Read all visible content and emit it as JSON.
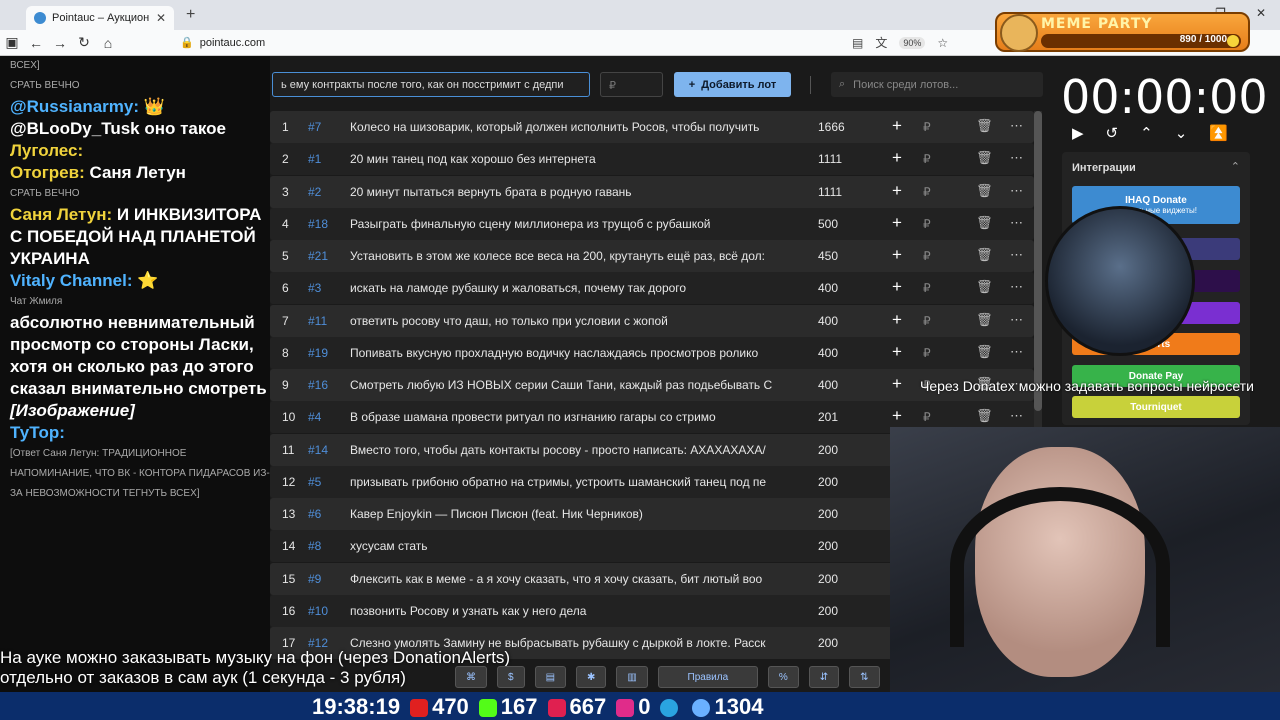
{
  "browser": {
    "tab_title": "Pointauc – Аукционы, лотереи",
    "url": "pointauc.com",
    "zoom": "90%"
  },
  "meme_party": {
    "title": "MEME PARTY",
    "progress": "890 / 1000",
    "progress_fraction": 0.89
  },
  "chat": {
    "lines": [
      {
        "kind": "small",
        "text": "ВСЕХ]"
      },
      {
        "kind": "small",
        "text": "СРАТЬ ВЕЧНО"
      },
      {
        "kind": "msg",
        "nick": "@Russianarmy:",
        "text": " 👑",
        "nick_color": "#4fb3ff"
      },
      {
        "kind": "msg",
        "nick": "@BLooDy_Tusk",
        "text": " оно такое",
        "nick_color": "#ffffff"
      },
      {
        "kind": "msg",
        "nick": "Луголес:",
        "text": "",
        "nick_color": "#f0d33c"
      },
      {
        "kind": "msg",
        "nick": "Отогрев:",
        "text": " Саня Летун",
        "nick_color": "#f0d33c"
      },
      {
        "kind": "small",
        "text": "СРАТЬ ВЕЧНО"
      },
      {
        "kind": "msg",
        "nick": "Саня Летун:",
        "text": " И ИНКВИЗИТОРА С ПОБЕДОЙ НАД ПЛАНЕТОЙ УКРАИНА",
        "nick_color": "#f0d33c"
      },
      {
        "kind": "msg",
        "nick": "Vitaly Channel:",
        "text": " ⭐",
        "nick_color": "#4fb3ff"
      },
      {
        "kind": "small",
        "text": "Чат Жмиля"
      },
      {
        "kind": "msg",
        "nick": "",
        "text": "абсолютно невнимательный просмотр со стороны Ласки, хотя он сколько раз до этого сказал внимательно смотреть",
        "nick_color": "#ffffff"
      },
      {
        "kind": "msg",
        "nick": "",
        "text": "[Изображение]",
        "nick_color": "#ffffff"
      },
      {
        "kind": "msg",
        "nick": "ТуТор:",
        "text": "",
        "nick_color": "#4fb3ff"
      },
      {
        "kind": "small",
        "text": "[Ответ Саня Летун: ТРАДИЦИОННОЕ НАПОМИНАНИЕ, ЧТО ВК - КОНТОРА ПИДАРАСОВ ИЗ-ЗА НЕВОЗМОЖНОСТИ ТЕГНУТЬ ВСЕХ]"
      }
    ]
  },
  "controls": {
    "lot_input": "ь ему контракты после того, как он посстримит с дедпи",
    "price_placeholder": "₽",
    "add_button": "Добавить лот",
    "search_placeholder": "Поиск среди лотов..."
  },
  "lots": [
    {
      "n": "1",
      "id": "#7",
      "name": "Колесо на шизоварик, который должен исполнить Росов, чтобы получить",
      "amount": "1666"
    },
    {
      "n": "2",
      "id": "#1",
      "name": "20 мин танец под как хорошо без интернета",
      "amount": "1111"
    },
    {
      "n": "3",
      "id": "#2",
      "name": "20 минут пытаться вернуть брата в родную гавань",
      "amount": "1111"
    },
    {
      "n": "4",
      "id": "#18",
      "name": "Разыграть финальную сцену миллионера из трущоб с рубашкой",
      "amount": "500"
    },
    {
      "n": "5",
      "id": "#21",
      "name": "Установить в этом же колесе все веса на 200, крутануть ещё раз, всё дол:",
      "amount": "450"
    },
    {
      "n": "6",
      "id": "#3",
      "name": "искать на ламоде рубашку и жаловаться, почему так дорого",
      "amount": "400"
    },
    {
      "n": "7",
      "id": "#11",
      "name": "ответить росову что даш, но только при условии с жопой",
      "amount": "400"
    },
    {
      "n": "8",
      "id": "#19",
      "name": "Попивать вкусную прохладную водичку наслаждаясь просмотров ролико",
      "amount": "400"
    },
    {
      "n": "9",
      "id": "#16",
      "name": "Смотреть любую ИЗ НОВЫХ серии Саши Тани, каждый раз подьебывать С",
      "amount": "400"
    },
    {
      "n": "10",
      "id": "#4",
      "name": "В образе шамана провести ритуал по изгнанию гагары со стримо",
      "amount": "201"
    },
    {
      "n": "11",
      "id": "#14",
      "name": "Вместо того, чтобы дать контакты росову - просто написать: АХАХАХАХА/",
      "amount": "200"
    },
    {
      "n": "12",
      "id": "#5",
      "name": "призывать грибоню обратно на стримы, устроить шаманский танец под пе",
      "amount": "200"
    },
    {
      "n": "13",
      "id": "#6",
      "name": "Кавер Enjoykin — Писюн Писюн (feat. Ник Черников)",
      "amount": "200"
    },
    {
      "n": "14",
      "id": "#8",
      "name": "хусусам стать",
      "amount": "200"
    },
    {
      "n": "15",
      "id": "#9",
      "name": "Флексить как в меме - а я хочу сказать, что я хочу сказать, бит лютый воо",
      "amount": "200"
    },
    {
      "n": "16",
      "id": "#10",
      "name": "позвонить Росову и узнать как у него дела",
      "amount": "200"
    },
    {
      "n": "17",
      "id": "#12",
      "name": "Слезно умолять Замину не выбрасывать рубашку с дыркой в локте. Расск",
      "amount": "200"
    }
  ],
  "timer": "00:00:00",
  "integrations": {
    "title": "Интеграции",
    "buttons": [
      {
        "label": "IHAQ Donate",
        "sub": "Уникальные виджеты!",
        "color": "#3d8bd1"
      },
      {
        "label": "er",
        "color": "#3b3b7a"
      },
      {
        "label": "",
        "color": "#2d0f4a"
      },
      {
        "label": "",
        "color": "#7a2fd1"
      },
      {
        "label": "Alerts",
        "color": "#f07b1a"
      },
      {
        "label": "Donate Pay",
        "color": "#37b34a"
      },
      {
        "label": "Tourniquet",
        "color": "#c8d13a"
      }
    ]
  },
  "ticker": "Через Donatex можно задавать вопросы нейросети",
  "subtitle": {
    "line1": "На ауке можно заказывать музыку на фон (через DonationAlerts)",
    "line2": "отдельно от заказов в сам аук (1 секунда - 3 рубля)"
  },
  "footer_tools": [
    "Правила"
  ],
  "stats": {
    "time": "19:38:19",
    "youtube": "470",
    "kick": "167",
    "vk": "667",
    "trovo": "0",
    "rutube": "",
    "telegram": "",
    "viewers": "1304"
  }
}
